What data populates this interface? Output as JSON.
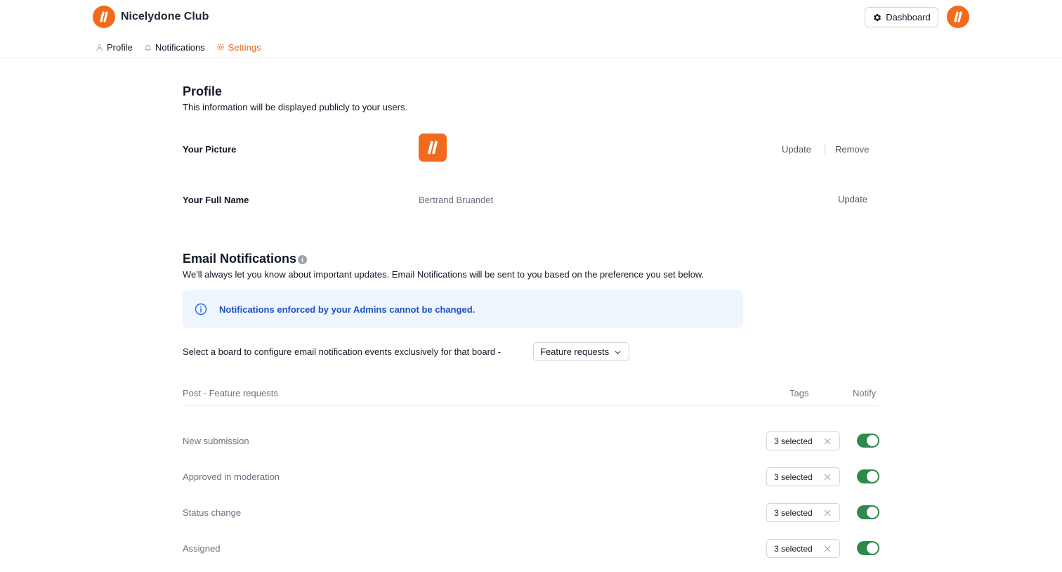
{
  "header": {
    "brand_name": "Nicelydone Club",
    "dashboard_label": "Dashboard"
  },
  "tabs": [
    {
      "label": "Profile",
      "icon": "user-icon",
      "active": false
    },
    {
      "label": "Notifications",
      "icon": "bell-icon",
      "active": false
    },
    {
      "label": "Settings",
      "icon": "gear-icon",
      "active": true
    }
  ],
  "profile": {
    "title": "Profile",
    "description": "This information will be displayed publicly to your users.",
    "picture_label": "Your Picture",
    "picture_update": "Update",
    "picture_remove": "Remove",
    "name_label": "Your Full Name",
    "name_value": "Bertrand Bruandet",
    "name_update": "Update"
  },
  "email": {
    "title": "Email Notifications",
    "description": "We'll always let you know about important updates. Email Notifications will be sent to you based on the preference you set below.",
    "alert": "Notifications enforced by your Admins cannot be changed.",
    "board_label": "Select a board to configure email notification events exclusively for that board -",
    "board_selected": "Feature requests"
  },
  "table": {
    "col_post": "Post - Feature requests",
    "col_tags": "Tags",
    "col_notify": "Notify",
    "rows": [
      {
        "label": "New submission",
        "tags": "3 selected",
        "notify": true
      },
      {
        "label": "Approved in moderation",
        "tags": "3 selected",
        "notify": true
      },
      {
        "label": "Status change",
        "tags": "3 selected",
        "notify": true
      },
      {
        "label": "Assigned",
        "tags": "3 selected",
        "notify": true
      }
    ]
  },
  "colors": {
    "brand": "#f26a1b",
    "active_tab": "#ea6a1c",
    "toggle_on": "#2e8a4a",
    "alert_bg": "#eef5fd",
    "alert_text": "#1e4fc4"
  }
}
